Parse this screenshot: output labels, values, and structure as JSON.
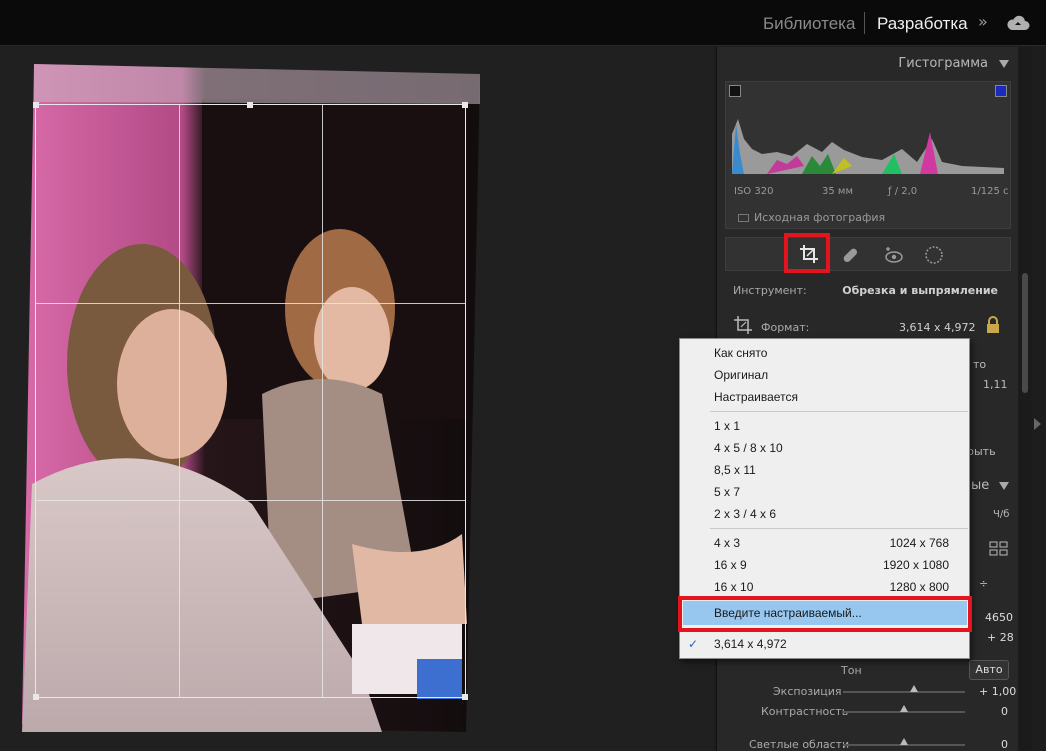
{
  "topbar": {
    "module_library": "Библиотека",
    "module_develop": "Разработка",
    "more": "»"
  },
  "histogram": {
    "title": "Гистограмма",
    "iso": "ISO 320",
    "focal": "35 мм",
    "aperture": "ƒ / 2,0",
    "shutter": "1/125 с",
    "original_label": "Исходная фотография"
  },
  "tool": {
    "label": "Инструмент:",
    "value": "Обрезка и выпрямление",
    "format_label": "Формат:",
    "format_value": "3,614 x 4,972"
  },
  "panel_partial": {
    "auto_fragment": "то",
    "value_fragment": "1,11",
    "close_fragment": "рыть",
    "section_fragment": "ые",
    "bw_fragment": "Ч/б",
    "temp_value": "4650",
    "tint_value": "+ 28"
  },
  "basic": {
    "tone_label": "Тон",
    "auto_label": "Авто",
    "exposure_label": "Экспозиция",
    "exposure_value": "+ 1,00",
    "contrast_label": "Контрастность",
    "contrast_value": "0",
    "highlights_label": "Светлые области",
    "highlights_value": "0"
  },
  "dropdown": {
    "group1": [
      "Как снято",
      "Оригинал",
      "Настраивается"
    ],
    "group2": [
      "1 x 1",
      "4 x 5  /  8 x 10",
      "8,5 x 11",
      "5 x 7",
      "2 x 3  /  4 x 6"
    ],
    "group3": [
      {
        "label": "4 x 3",
        "size": "1024 x 768"
      },
      {
        "label": "16 x 9",
        "size": "1920 x 1080"
      },
      {
        "label": "16 x 10",
        "size": "1280 x 800"
      }
    ],
    "custom_entry": "Введите настраиваемый...",
    "current": "3,614 x 4,972",
    "check": "✓"
  },
  "colors": {
    "highlight_red": "#e3141d",
    "menu_highlight": "#97c6ee"
  }
}
